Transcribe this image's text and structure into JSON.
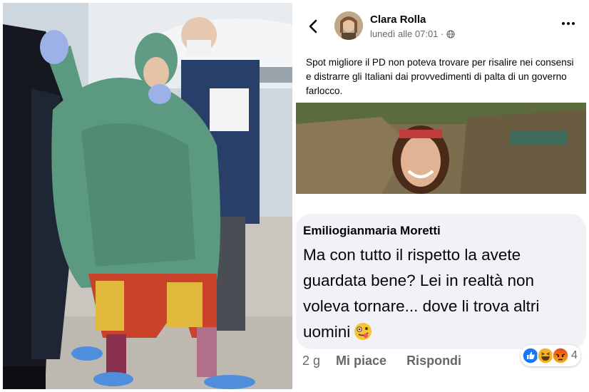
{
  "post": {
    "author": "Clara Rolla",
    "timestamp": "lunedì alle 07:01 ·",
    "privacy_icon": "globe-icon",
    "back_icon": "chevron-left-icon",
    "more_icon": "more-dots-icon",
    "text": "Spot migliore il PD non poteva trovare per risalire nei consensi e distrarre gli Italiani dai provvedimenti di palta di un governo farlocco."
  },
  "comment": {
    "author": "Emiliogianmaria Moretti",
    "text": "Ma con tutto il rispetto la avete guardata bene? Lei in realtà non voleva tornare... dove li trova altri uomini",
    "emoji": "zany-face-emoji",
    "time": "2 g",
    "like_label": "Mi piace",
    "reply_label": "Rispondi",
    "reactions": [
      "like-reaction",
      "haha-reaction",
      "angry-reaction"
    ],
    "reaction_count": "4"
  },
  "colors": {
    "comment_bg": "#f0f2f5",
    "meta_text": "#65676b",
    "like_blue": "#1877f2",
    "reaction_yellow": "#f7b125",
    "reaction_angry": "#e9710f"
  }
}
